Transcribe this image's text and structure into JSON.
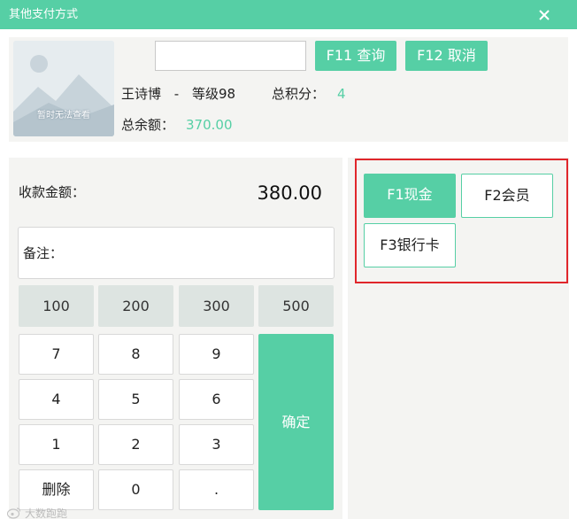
{
  "window": {
    "title": "其他支付方式"
  },
  "member": {
    "avatar_text": "暂时无法查看",
    "search_value": "",
    "query_label": "F11 查询",
    "cancel_label": "F12 取消",
    "name": "王诗博",
    "separator": "-",
    "level": "等级98",
    "points_label": "总积分：",
    "points_value": "4",
    "balance_label": "总余额：",
    "balance_value": "370.00"
  },
  "payment": {
    "amount_label": "收款金额：",
    "amount_value": "380.00",
    "remark_label": "备注：",
    "quick_amounts": [
      "100",
      "200",
      "300",
      "500"
    ],
    "keys": [
      "7",
      "8",
      "9",
      "4",
      "5",
      "6",
      "1",
      "2",
      "3",
      "删除",
      "0",
      "."
    ],
    "confirm_label": "确定"
  },
  "methods": {
    "cash": "F1现金",
    "member": "F2会员",
    "bank": "F3银行卡"
  },
  "watermark": {
    "text": "大数跑跑"
  },
  "colors": {
    "accent": "#56cfa5",
    "highlight": "#e0262b",
    "panel": "#f4f4f2"
  }
}
